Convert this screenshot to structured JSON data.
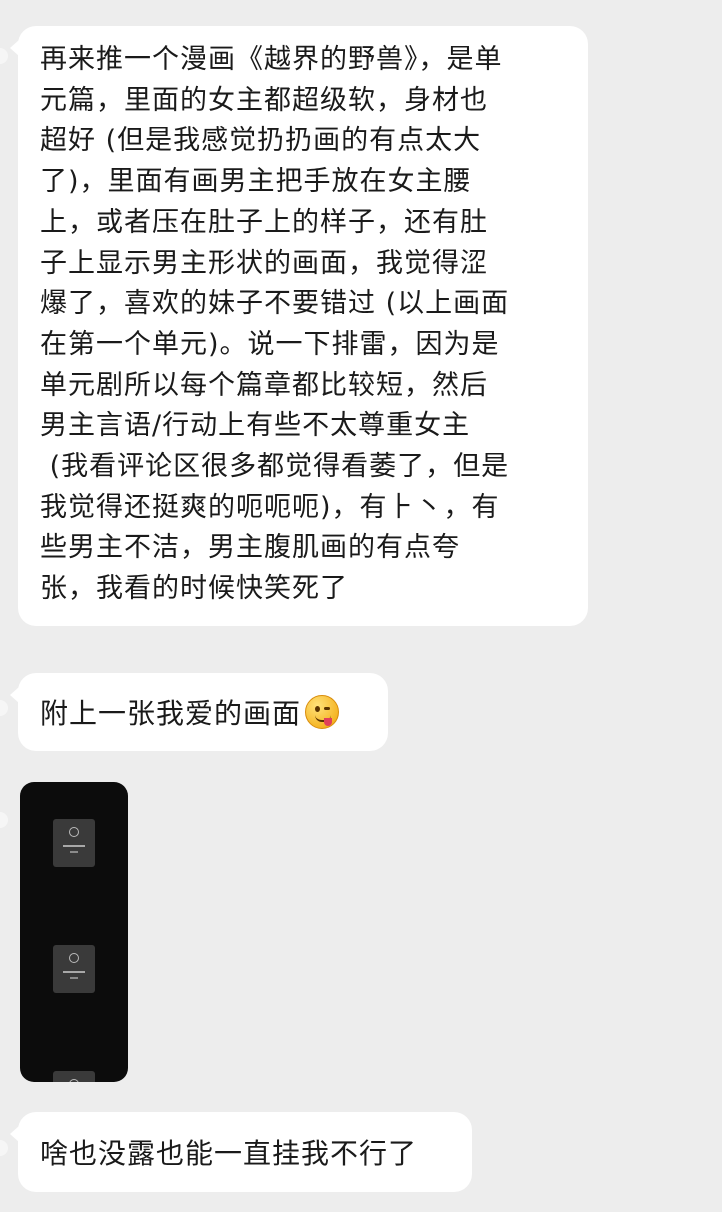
{
  "messages": [
    {
      "type": "text",
      "lines": [
        "再来推一个漫画《越界的野兽》，是单",
        "元篇，里面的女主都超级软，身材也",
        "超好 (但是我感觉扔扔画的有点太大",
        "了)，里面有画男主把手放在女主腰",
        "上，或者压在肚子上的样子，还有肚",
        "子上显示男主形状的画面，我觉得涩",
        "爆了，喜欢的妹子不要错过 (以上画面",
        "在第一个单元)。说一下排雷，因为是",
        "单元剧所以每个篇章都比较短，然后",
        "男主言语/行动上有些不太尊重女主",
        " (我看评论区很多都觉得看萎了，但是",
        "我觉得还挺爽的呃呃呃)，有⺊丶，有",
        "些男主不洁，男主腹肌画的有点夸",
        "张，我看的时候快笑死了"
      ]
    },
    {
      "type": "text",
      "text": "附上一张我爱的画面",
      "emoji": "tongue-out-emoji"
    },
    {
      "type": "image",
      "icon": "image-thumbnail"
    },
    {
      "type": "text",
      "text": "啥也没露也能一直挂我不行了"
    }
  ],
  "colors": {
    "background": "#ededed",
    "bubble": "#ffffff",
    "text": "#1a1a1a",
    "image_bg": "#0c0c0c"
  }
}
